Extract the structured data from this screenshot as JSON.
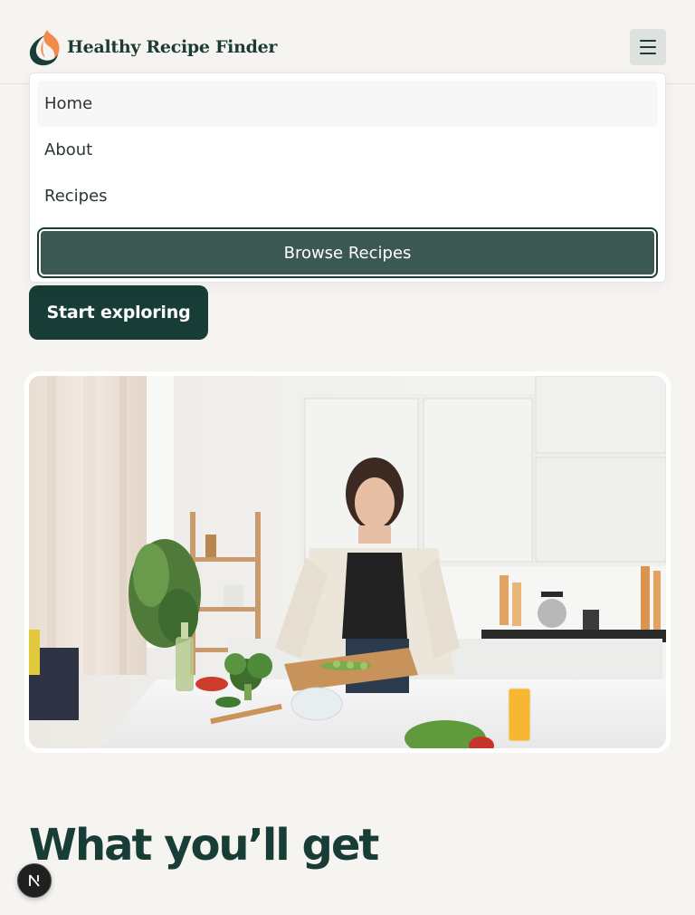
{
  "header": {
    "logo_text": "Healthy Recipe Finder",
    "logo_icon": "flame-leaf-icon",
    "menu_icon": "hamburger-menu-icon"
  },
  "dropdown": {
    "items": [
      {
        "label": "Home",
        "active": true
      },
      {
        "label": "About",
        "active": false
      },
      {
        "label": "Recipes",
        "active": false
      }
    ],
    "browse_label": "Browse Recipes"
  },
  "hero": {
    "cta_label": "Start exploring",
    "image_subject": "woman-chopping-cucumber-in-kitchen"
  },
  "section": {
    "title": "What you’ll get"
  },
  "badge": {
    "letter": "N"
  },
  "colors": {
    "background": "#f6f4f1",
    "primary_dark": "#173d36",
    "browse_button": "#3b5852",
    "accent_orange": "#f28b4a",
    "menu_button_bg": "#dde1df"
  }
}
